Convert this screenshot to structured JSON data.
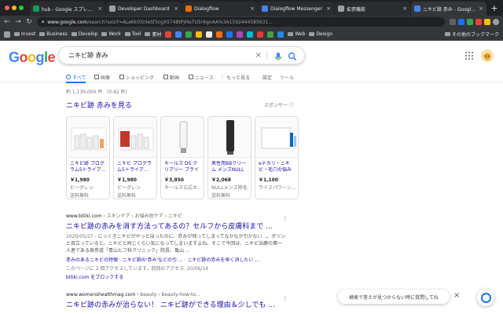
{
  "browser": {
    "tabs": [
      {
        "title": "hub - Google スプレッドシ...",
        "favicon_color": "#0f9d58",
        "active": false
      },
      {
        "title": "Developer Dashboard",
        "favicon_color": "#9aa0a6",
        "active": false
      },
      {
        "title": "Dialogflow",
        "favicon_color": "#ef6c00",
        "active": false
      },
      {
        "title": "Dialogflow Messenger",
        "favicon_color": "#4285f4",
        "active": false
      },
      {
        "title": "拡張機能",
        "favicon_color": "#9aa0a6",
        "active": false
      },
      {
        "title": "ニキビ跡 赤み - Google 検...",
        "favicon_color": "#4285f4",
        "active": true
      }
    ],
    "close_glyph": "×",
    "new_tab_glyph": "+",
    "url_host": "www.google.com",
    "url_path": "/search?sxsrf=ALeKk03nleSf3cgX5748tPjMaTU5r6gnAA%3A1592444585631...",
    "bookmarks": [
      "Invest",
      "Business",
      "Develop",
      "Work",
      "Tool",
      "素材",
      "Web",
      "Design"
    ],
    "other_bookmarks": "その他のブックマーク"
  },
  "google": {
    "logo_letters": [
      {
        "ch": "G",
        "color": "#4285f4"
      },
      {
        "ch": "o",
        "color": "#ea4335"
      },
      {
        "ch": "o",
        "color": "#fbbc05"
      },
      {
        "ch": "g",
        "color": "#4285f4"
      },
      {
        "ch": "l",
        "color": "#34a853"
      },
      {
        "ch": "e",
        "color": "#ea4335"
      }
    ],
    "query": "ニキビ跡 赤み",
    "clear_glyph": "×"
  },
  "search_tabs": [
    {
      "label": "すべて",
      "active": true,
      "icon": "search-icon"
    },
    {
      "label": "画像",
      "active": false,
      "icon": "image-icon"
    },
    {
      "label": "ショッピング",
      "active": false,
      "icon": "tag-icon"
    },
    {
      "label": "動画",
      "active": false,
      "icon": "video-icon"
    },
    {
      "label": "ニュース",
      "active": false,
      "icon": "news-icon"
    },
    {
      "label": "もっと見る",
      "active": false,
      "icon": "more-icon"
    },
    {
      "label": "設定",
      "active": false,
      "icon": ""
    },
    {
      "label": "ツール",
      "active": false,
      "icon": ""
    }
  ],
  "results_count": "約 1,130,000 件 （0.42 秒）",
  "shopping": {
    "title": "ニキビ跡 赤みを見る",
    "sponsor": "スポンサー ⓘ",
    "products": [
      {
        "name": "ニキビ跡 プログラム5トライア...",
        "price": "￥1,980",
        "store": "ビーグレン",
        "ship": "送料無料"
      },
      {
        "name": "ニキビ プログラム5トライア...",
        "price": "￥1,980",
        "store": "ビーグレン",
        "ship": "送料無料"
      },
      {
        "name": "キールズ DS クリアリー ブライトエ...",
        "price": "￥3,850",
        "store": "キールズ公式オ...",
        "ship": ""
      },
      {
        "name": "男性用BBクリーム メンズNULL",
        "price": "￥2,068",
        "store": "NULLメンズ除毛...",
        "ship": "送料無料"
      },
      {
        "name": "eテカリ・ニキビ・毛穴の悩み",
        "price": "￥1,100",
        "store": "ライスパワーシ...",
        "ship": ""
      }
    ]
  },
  "results": [
    {
      "site": "www.bitiki.com",
      "path": " › スキンケア › お悩み別ケア › ニキビ",
      "title": "ニキビ跡の赤みを消す方法ってあるの？セルフから皮膚科まで ...",
      "date": "2020/05/27",
      "desc": " - にっくきニキビがやっと治ったのに、赤みが残ってしまってなかなか引かない...。ボツンと目立っていると、ニキビと同じくらい気になってしまいますよね。そこで今回は、ニキビ治療の第一人者である表参道「青山ヒフ科クリニック」院長、亀山 ...",
      "links": "赤みのあるニキビの特徴 · ニキビ跡の'赤み'などの引 ... · ニキビ跡の赤みを早く消したい ...",
      "visit": "このページに 2 回アクセスしています。前回のアクセス: 20/06/14",
      "block": "bitiki.com をブロックする",
      "more": "⋮"
    },
    {
      "site": "www.womenshealthmag.com",
      "path": " › beauty › beauty-how-to...",
      "title": "ニキビ跡の赤みが治らない！ ニキビ跡ができる理由＆少しでも ...",
      "date": "",
      "desc": "",
      "links": "",
      "visit": "",
      "block": "",
      "more": "⋮"
    }
  ],
  "feedback_text": "検索で答えが見つからない時に質問してね",
  "feedback_close": "×"
}
